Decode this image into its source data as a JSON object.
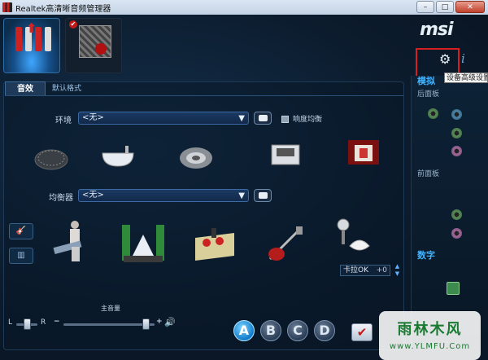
{
  "window": {
    "title": "Realtek高清晰音频管理器",
    "minimize": "–",
    "maximize": "□",
    "close": "✕"
  },
  "header": {
    "brand": "msi",
    "settings_icon": "gear-icon",
    "info_icon": "i",
    "tooltip": "设备高级设置"
  },
  "tabs": {
    "effects": "音效",
    "default_format": "默认格式"
  },
  "environment": {
    "label": "环境",
    "value": "<无>",
    "loudness_label": "响度均衡"
  },
  "equalizer": {
    "label": "均衡器",
    "value": "<无>"
  },
  "karaoke": {
    "label": "卡拉OK",
    "value": "+0"
  },
  "volume": {
    "label": "主音量",
    "left": "L",
    "right": "R",
    "minus": "−",
    "plus": "+",
    "balance": 0.5,
    "level": 0.9
  },
  "presets": [
    "A",
    "B",
    "C",
    "D"
  ],
  "right_panel": {
    "analog": "模拟",
    "back_panel": "后面板",
    "front_panel": "前面板",
    "digital": "数字"
  },
  "watermark": {
    "title": "雨林木风",
    "url": "www.YLMFU.Com"
  },
  "colors": {
    "accent": "#3fb3ff",
    "background": "#0c1c2e",
    "highlight_box": "#d62020"
  }
}
